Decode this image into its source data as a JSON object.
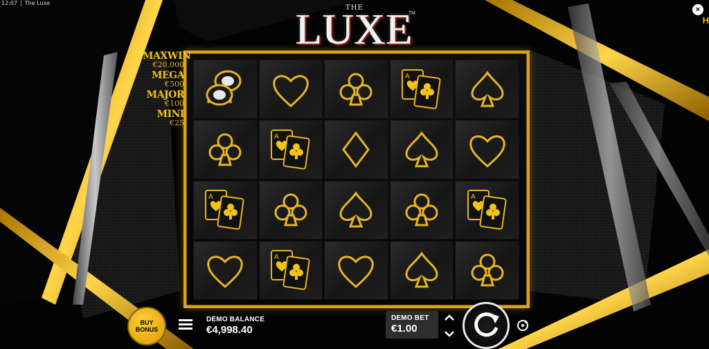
{
  "status_bar": {
    "time": "12:07",
    "separator": "|",
    "title": "The Luxe"
  },
  "close_label": "×",
  "corner_mark": "H",
  "logo": {
    "the": "THE",
    "main": "LUXE",
    "tm": "TM"
  },
  "jackpots": [
    {
      "name": "MAXWIN",
      "value": "€20,000"
    },
    {
      "name": "MEGA",
      "value": "€500"
    },
    {
      "name": "MAJOR",
      "value": "€100"
    },
    {
      "name": "MINI",
      "value": "€25"
    }
  ],
  "reels": [
    [
      "chips",
      "heart",
      "club",
      "cards",
      "spade"
    ],
    [
      "club",
      "cards",
      "diamond",
      "spade",
      "heart"
    ],
    [
      "cards",
      "club",
      "spade",
      "club",
      "cards"
    ],
    [
      "heart",
      "cards",
      "heart",
      "spade",
      "club"
    ]
  ],
  "controls": {
    "buy_bonus_line1": "BUY",
    "buy_bonus_line2": "BONUS",
    "balance_label": "DEMO BALANCE",
    "balance_value": "€4,998.40",
    "bet_label": "DEMO BET",
    "bet_value": "€1.00"
  },
  "colors": {
    "gold": "#d9a41a",
    "gold_light": "#f0c419"
  }
}
